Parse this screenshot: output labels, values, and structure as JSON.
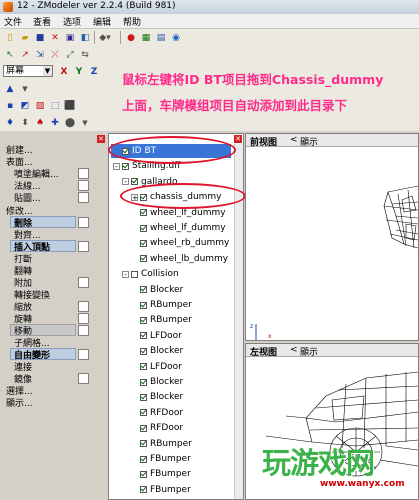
{
  "window": {
    "title": "12 - ZModeler ver 2.2.4 (Build 981)",
    "controls": [
      "minimize",
      "maximize",
      "close"
    ]
  },
  "menu": [
    "文件",
    "查看",
    "选项",
    "编辑",
    "帮助"
  ],
  "toolbar": {
    "display_select": "屏幕",
    "axis_buttons": [
      "X",
      "Y",
      "Z"
    ]
  },
  "annotation": {
    "line1": "鼠标左键将ID BT项目拖到Chassis_dummy",
    "line2": "上面，车牌模组项目自动添加到此目录下"
  },
  "left_panel": {
    "group1": {
      "title": "創建...",
      "items": [
        "表面...",
        "噴塗編輯...",
        "法線...",
        "貼圖..."
      ]
    },
    "group2": {
      "title": "修改...",
      "items": [
        "刪除",
        "對齊...",
        "插入頂點",
        "打斷",
        "翻轉",
        "附加",
        "轉接變換",
        "縮放",
        "旋轉",
        "移動",
        "子網格...",
        "自由變形",
        "連接",
        "鏡像"
      ]
    },
    "footer": [
      "選擇...",
      "顯示..."
    ]
  },
  "tree": {
    "items": [
      {
        "label": "ID BT",
        "level": 0,
        "checked": true,
        "selected": true
      },
      {
        "label": "Stalling.dff",
        "level": 0,
        "checked": true,
        "expand": "-"
      },
      {
        "label": "gallardo",
        "level": 1,
        "checked": true,
        "expand": "-"
      },
      {
        "label": "chassis_dummy",
        "level": 2,
        "checked": true,
        "expand": "+"
      },
      {
        "label": "wheel_lf_dummy",
        "level": 2,
        "checked": true
      },
      {
        "label": "wheel_lf_dummy",
        "level": 2,
        "checked": true
      },
      {
        "label": "wheel_rb_dummy",
        "level": 2,
        "checked": true
      },
      {
        "label": "wheel_lb_dummy",
        "level": 2,
        "checked": true
      },
      {
        "label": "Collision",
        "level": 1,
        "checked": false,
        "expand": "-"
      },
      {
        "label": "Blocker",
        "level": 2,
        "checked": true
      },
      {
        "label": "RBumper",
        "level": 2,
        "checked": true
      },
      {
        "label": "RBumper",
        "level": 2,
        "checked": true
      },
      {
        "label": "LFDoor",
        "level": 2,
        "checked": true
      },
      {
        "label": "Blocker",
        "level": 2,
        "checked": true
      },
      {
        "label": "LFDoor",
        "level": 2,
        "checked": true
      },
      {
        "label": "Blocker",
        "level": 2,
        "checked": true
      },
      {
        "label": "Blocker",
        "level": 2,
        "checked": true
      },
      {
        "label": "RFDoor",
        "level": 2,
        "checked": true
      },
      {
        "label": "RFDoor",
        "level": 2,
        "checked": true
      },
      {
        "label": "RBumper",
        "level": 2,
        "checked": true
      },
      {
        "label": "FBumper",
        "level": 2,
        "checked": true
      },
      {
        "label": "FBumper",
        "level": 2,
        "checked": true
      },
      {
        "label": "FBumper",
        "level": 2,
        "checked": true
      }
    ]
  },
  "viewports": {
    "top": {
      "title": "前视图",
      "display": "顯示"
    },
    "bottom": {
      "title": "左视图",
      "display": "顯示"
    }
  },
  "watermark": {
    "text": "玩游戏网",
    "url": "www.wanyx.com"
  },
  "colors": {
    "annotation": "#ff2a8a",
    "highlight_ring": "#e0142a",
    "selected_bg": "#3875d7",
    "watermark": "#3bb24a"
  }
}
